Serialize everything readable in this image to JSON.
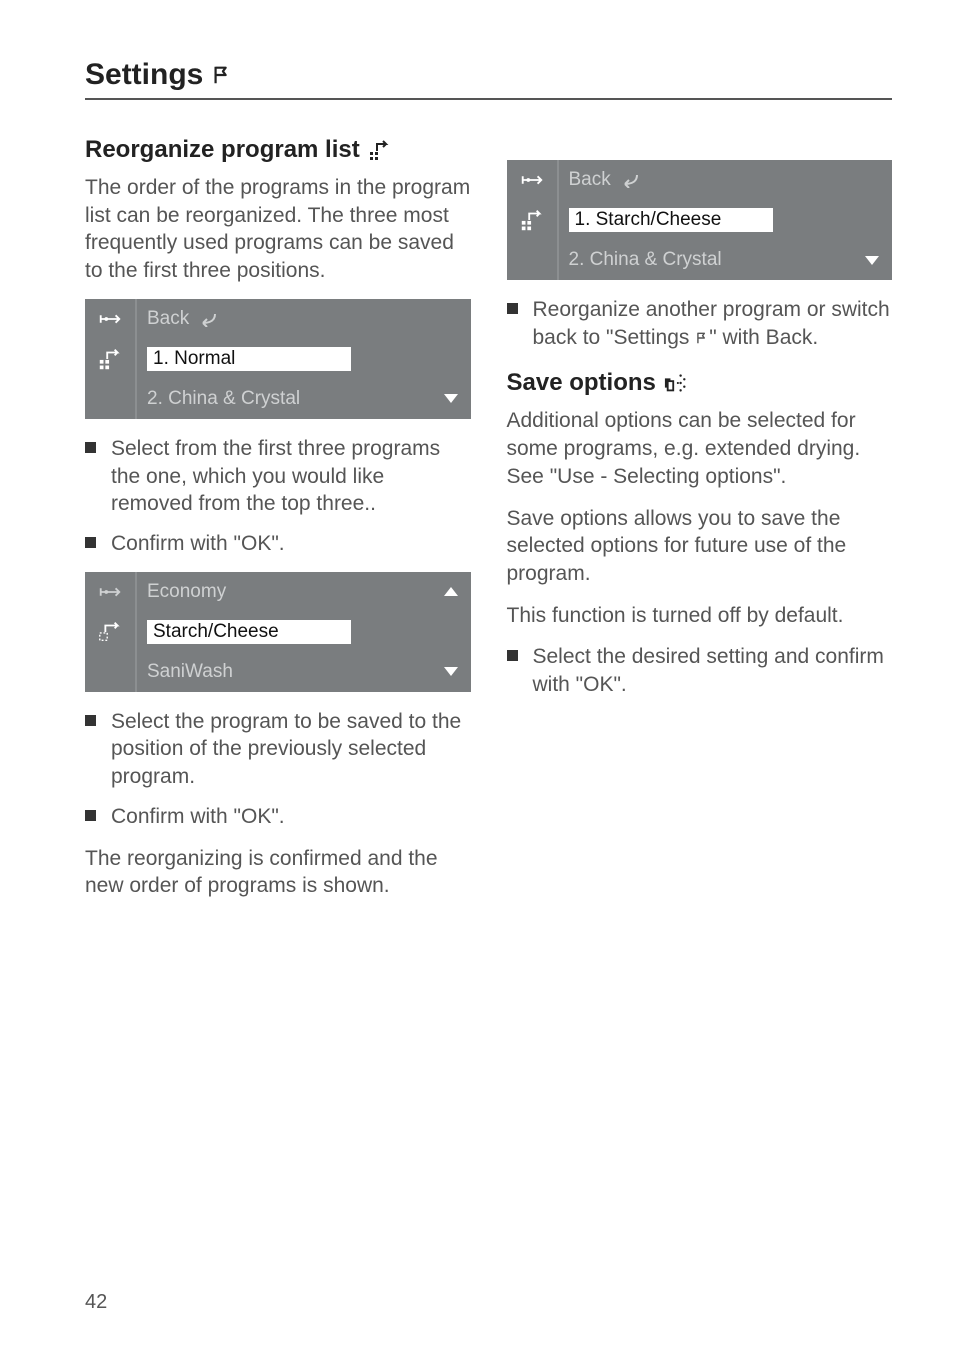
{
  "page_number": "42",
  "title": "Settings",
  "left": {
    "heading": "Reorganize program list",
    "intro": "The order of the programs in the program list can be reorganized. The three most frequently used programs can be saved to the first three positions.",
    "lcd1": {
      "row1": "Back",
      "row2_selected": "1. Normal",
      "row3": "2. China & Crystal"
    },
    "step1": "Select from the first three programs the one, which you would like removed from the top three..",
    "step2": "Confirm with \"OK\".",
    "lcd2": {
      "row1": "Economy",
      "row2_selected": "Starch/Cheese",
      "row3": "SaniWash"
    },
    "step3": "Select the program to be saved to the position of the previously selected program.",
    "step4": "Confirm with \"OK\".",
    "outro": "The reorganizing is confirmed and the new order of programs is shown."
  },
  "right": {
    "lcd3": {
      "row1": "Back",
      "row2_selected": "1. Starch/Cheese",
      "row3": "2. China & Crystal"
    },
    "step1_a": "Reorganize another program or switch back to \"Settings ",
    "step1_b": "\" with Back.",
    "heading2": "Save options",
    "p1": "Additional options can be selected for some programs, e.g. extended drying. See \"Use - Selecting options\".",
    "p2": "Save options allows you to save the selected options for future use of the program.",
    "p3": "This function is turned off by default.",
    "step2": "Select the desired setting and confirm with \"OK\"."
  }
}
